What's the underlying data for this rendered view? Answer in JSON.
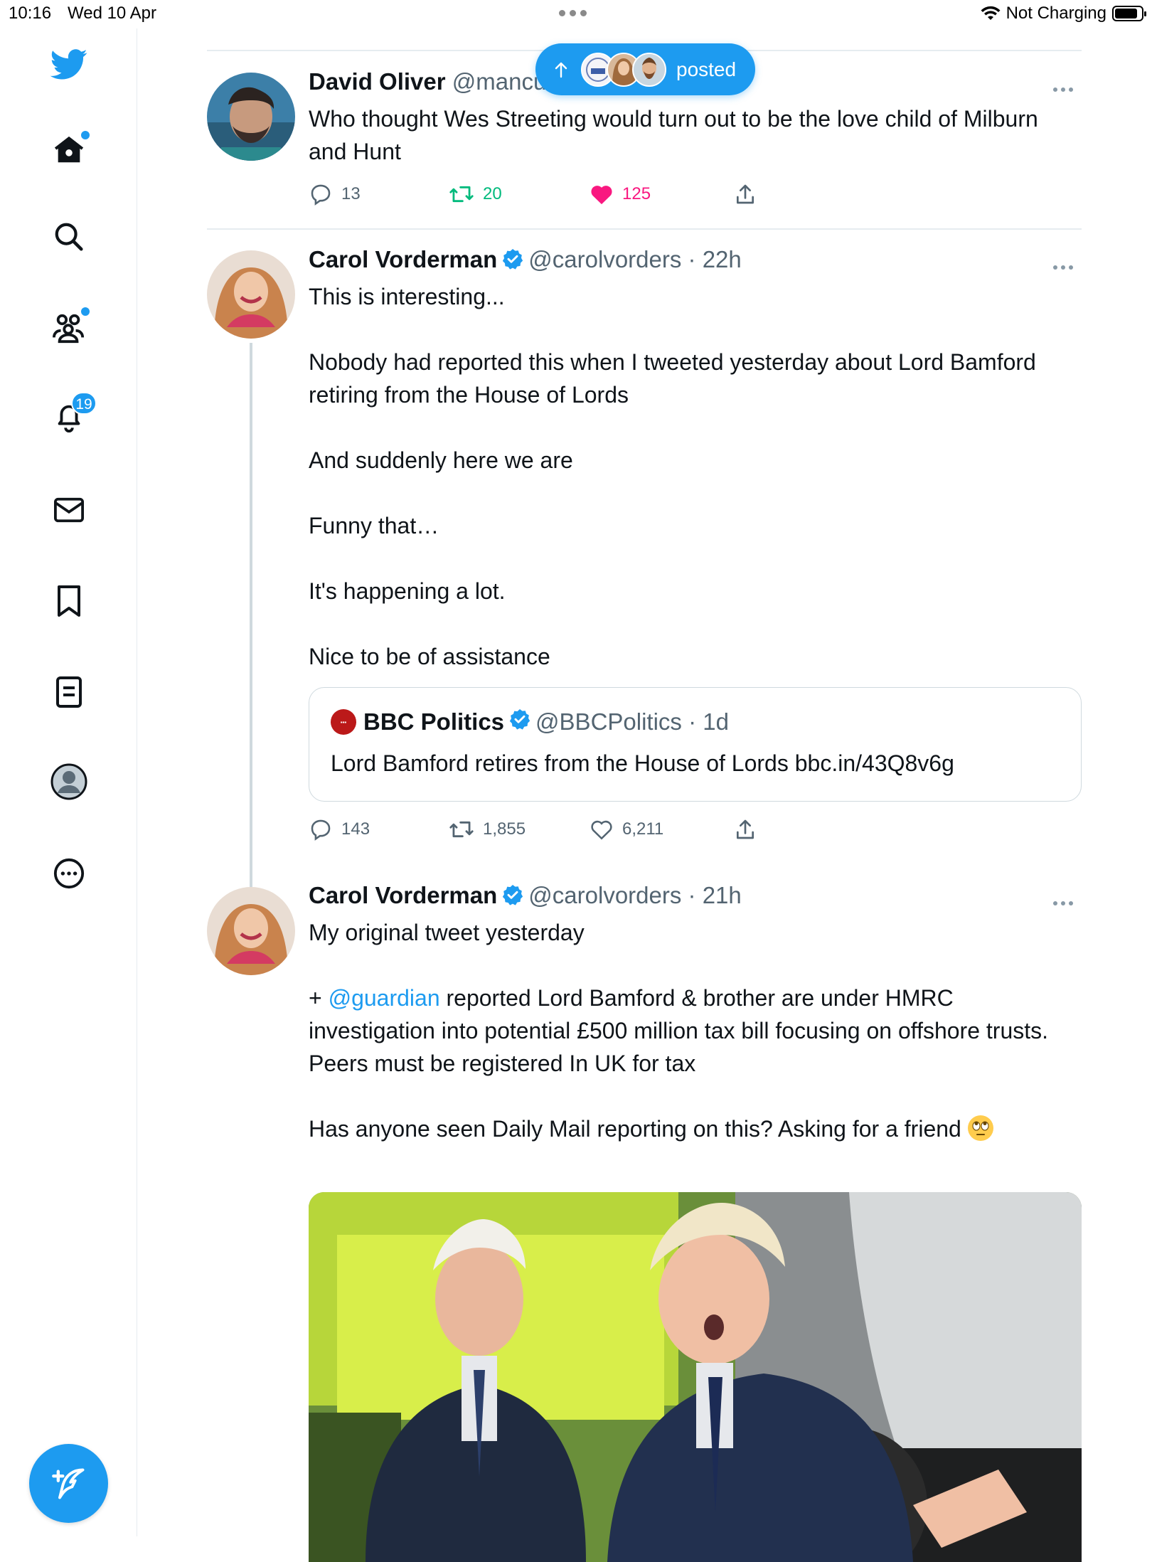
{
  "status_bar": {
    "time": "10:16",
    "date": "Wed 10 Apr",
    "charging": "Not Charging",
    "battery_level": 0.85
  },
  "sidebar": {
    "notifications_badge": "19",
    "items": [
      "twitter-logo",
      "home-icon",
      "search-icon",
      "communities-icon",
      "notifications-icon",
      "messages-icon",
      "bookmarks-icon",
      "lists-icon",
      "profile-icon",
      "more-icon"
    ]
  },
  "new_posts_pill": {
    "label": "posted"
  },
  "tweets": [
    {
      "name": "David Oliver",
      "handle": "@mancu",
      "text": "Who thought Wes Streeting would turn out to be the love child of Milburn and Hunt",
      "replies": "13",
      "retweets": "20",
      "likes": "125"
    },
    {
      "name": "Carol Vorderman",
      "handle": "@carolvorders",
      "time": "· 22h",
      "paragraphs": [
        "This is interesting...",
        "Nobody had reported this when I tweeted yesterday about Lord Bamford retiring from the House of Lords",
        "And suddenly here we are",
        "Funny that…",
        "It's happening a lot.",
        "Nice to be of assistance"
      ],
      "quote": {
        "name": "BBC Politics",
        "handle": "@BBCPolitics",
        "time": "· 1d",
        "text": "Lord Bamford retires from the House of Lords bbc.in/43Q8v6g"
      },
      "replies": "143",
      "retweets": "1,855",
      "likes": "6,211"
    },
    {
      "name": "Carol Vorderman",
      "handle": "@carolvorders",
      "time": "· 21h",
      "line1": "My original tweet yesterday",
      "plus": "+ ",
      "mention": "@guardian",
      "line2": " reported Lord Bamford & brother are under HMRC investigation into potential £500 million tax bill focusing on offshore trusts.",
      "line3": "Peers must be registered In UK for tax",
      "line4": "Has anyone seen Daily Mail reporting on this? Asking for a friend "
    }
  ],
  "colors": {
    "accent": "#1d9bf0",
    "retweet": "#00ba7c",
    "like": "#f91880",
    "secondary_text": "#536471"
  }
}
